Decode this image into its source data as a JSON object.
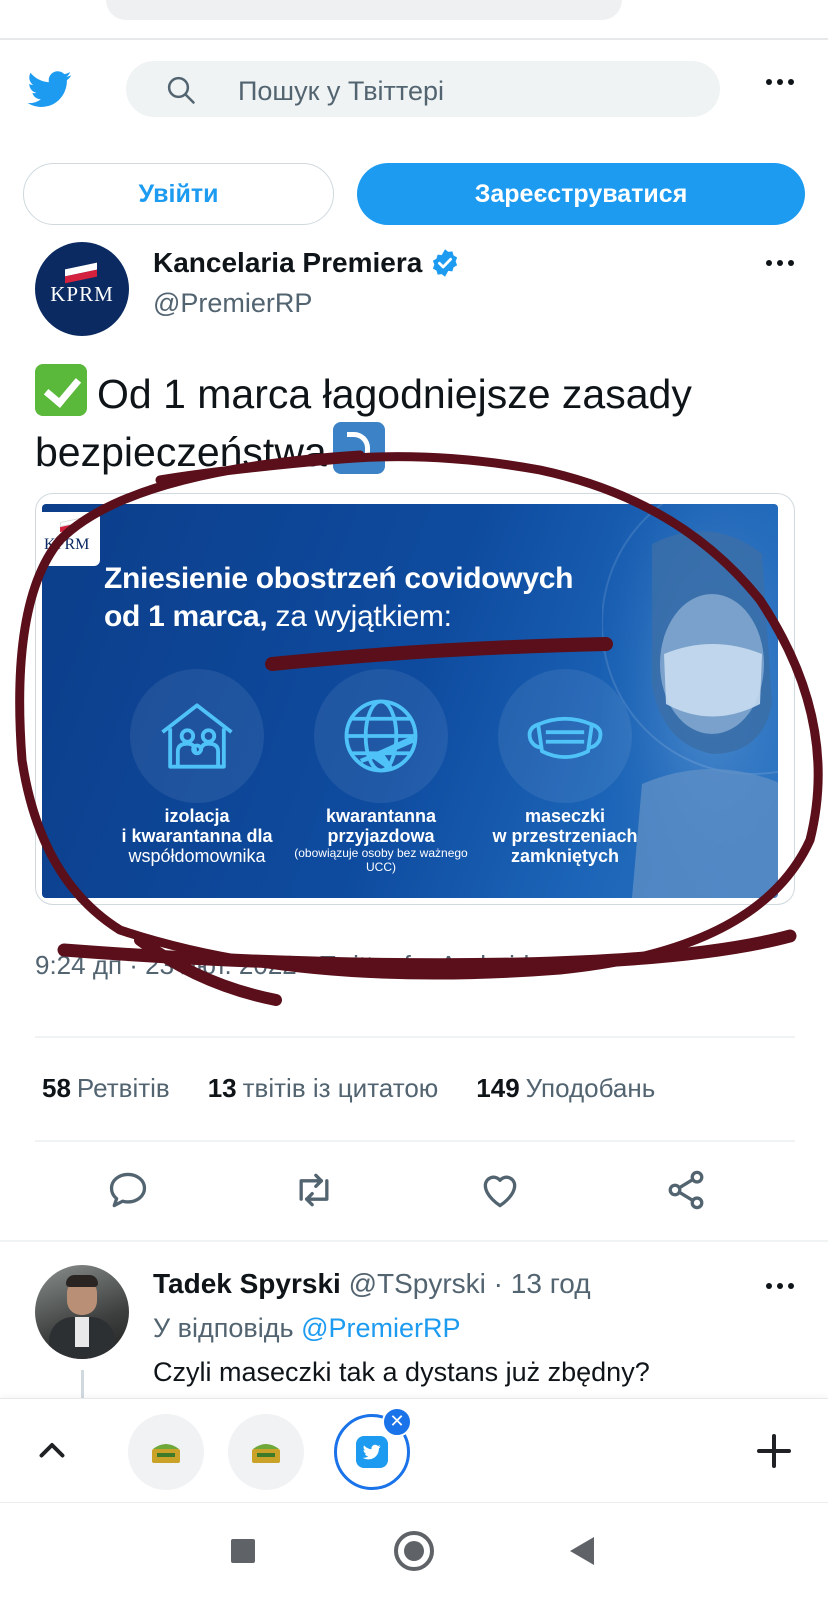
{
  "search": {
    "placeholder": "Пошук у Твіттері"
  },
  "auth": {
    "login_label": "Увійти",
    "signup_label": "Зареєструватися"
  },
  "tweet": {
    "author_name": "Kancelaria Premiera",
    "author_handle": "@PremierRP",
    "avatar_text": "KPRM",
    "text_line1": "Od 1 marca łagodniejsze zasady",
    "text_line2": "bezpieczeństwa",
    "media": {
      "logo_text": "KPRM",
      "headline_line1": "Zniesienie obostrzeń covidowych",
      "headline_line2_bold": "od 1 marca,",
      "headline_line2_thin": " za wyjątkiem:",
      "items": [
        {
          "line1": "izolacja",
          "line2": "i kwarantanna dla",
          "line3": "współdomownika",
          "note": ""
        },
        {
          "line1": "kwarantanna",
          "line2": "przyjazdowa",
          "line3": "",
          "note": "(obowiązuje osoby bez ważnego UCC)"
        },
        {
          "line1": "maseczki",
          "line2": "w przestrzeniach",
          "line3": "zamkniętych",
          "note": ""
        }
      ]
    },
    "meta": "9:24 дп · 23 лют. 2022 · Twitter for Android",
    "stats": {
      "retweets_count": "58",
      "retweets_label": "Ретвітів",
      "quotes_count": "13",
      "quotes_label": "твітів із цитатою",
      "likes_count": "149",
      "likes_label": "Уподобань"
    }
  },
  "reply": {
    "name": "Tadek Spyrski",
    "handle_time": " @TSpyrski · 13 год",
    "reply_to_prefix": "У відповідь ",
    "reply_to_handle": "@PremierRP",
    "text": "Czyli maseczki tak a dystans już zbędny?"
  },
  "colors": {
    "brand": "#1d9bf0",
    "scribble": "#5a0f1a",
    "media_bg": "#0e4b9f"
  }
}
